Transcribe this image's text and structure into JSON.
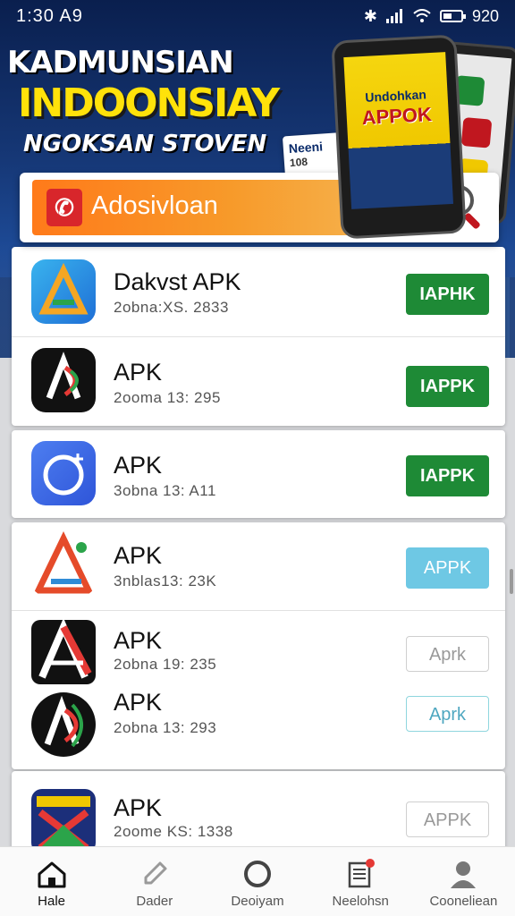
{
  "status_bar": {
    "time": "1:30 A9",
    "battery": "920"
  },
  "hero": {
    "line1": "KADMUNSIAN",
    "line2": "INDOONSIAY",
    "line3": "NGOKSAN STOVEN",
    "phone_title_small": "Undohkan",
    "phone_title_large": "APPOK",
    "card_title": "Neeni",
    "card_sub": "108"
  },
  "search": {
    "label": "Adosivloan"
  },
  "apps": [
    {
      "name": "Dakvst APK",
      "meta": "2obna:XS. 2833",
      "button": "IAPHK"
    },
    {
      "name": "APK",
      "meta": "2ooma 13: 295",
      "button": "IAPPK"
    },
    {
      "name": "APK",
      "meta": "3obna 13: A11",
      "button": "IAPPK"
    },
    {
      "name": "APK",
      "meta": "3nblas13: 23K",
      "button": "APPK"
    },
    {
      "name": "APK",
      "meta": "2obna 19: 235",
      "button": "Aprk"
    },
    {
      "name": "APK",
      "meta": "2obna 13: 293",
      "button": "Aprk"
    },
    {
      "name": "APK",
      "meta": "2oome KS: 1338",
      "button": "APPK"
    }
  ],
  "nav": [
    {
      "label": "Hale",
      "icon": "home-icon"
    },
    {
      "label": "Dader",
      "icon": "pencil-icon"
    },
    {
      "label": "Deoiyam",
      "icon": "circle-icon"
    },
    {
      "label": "Neelohsn",
      "icon": "news-icon"
    },
    {
      "label": "Cooneliean",
      "icon": "profile-icon"
    }
  ],
  "colors": {
    "accent_green": "#1e8a36",
    "hero_yellow": "#ffe20a",
    "hero_blue": "#163877",
    "orange": "#ff7a1a"
  }
}
